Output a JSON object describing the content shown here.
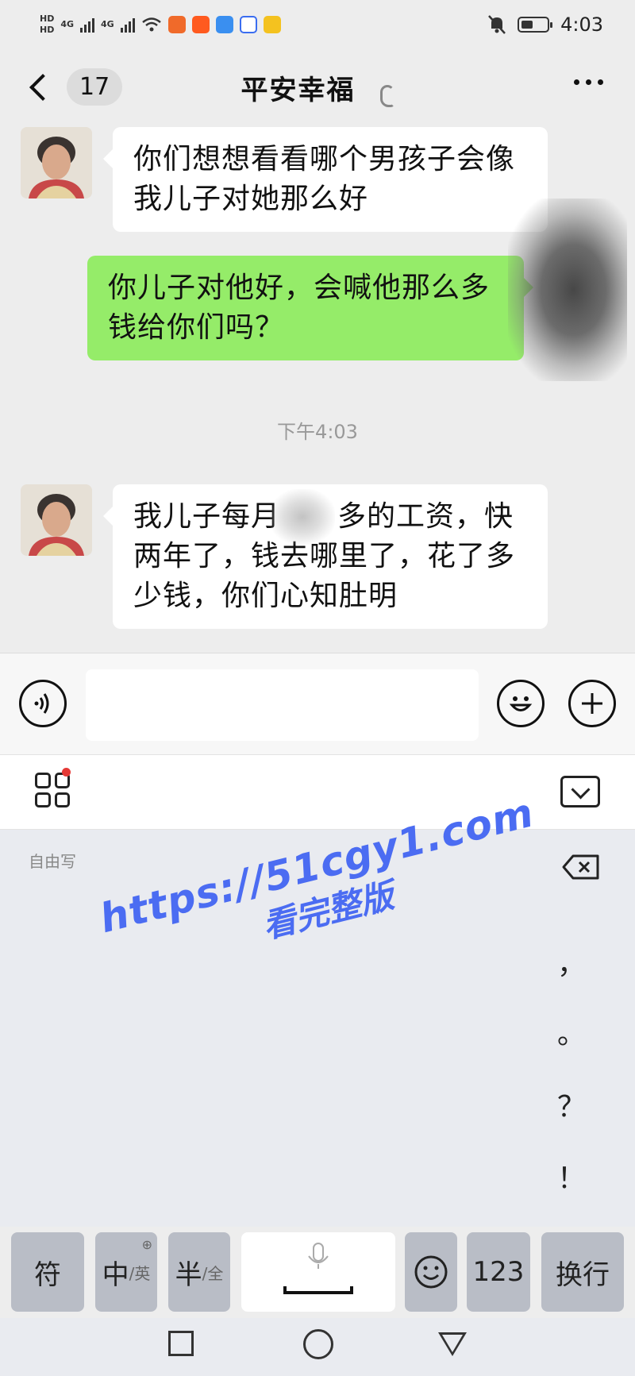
{
  "status_bar": {
    "time": "4:03",
    "network_1": "4G",
    "network_2": "4G",
    "hd_1": "HD",
    "hd_2": "HD",
    "icons": [
      "signal-icon",
      "wifi-icon",
      "mute-bell-icon",
      "battery-icon"
    ]
  },
  "header": {
    "back_count": "17",
    "title": "平安幸福"
  },
  "messages": [
    {
      "side": "in",
      "text_line1": "你们想想看看哪个男孩子会像",
      "text_line2": "我儿子对她那么好"
    },
    {
      "side": "out",
      "text_line1": "你儿子对他好，会喊他那么多",
      "text_line2": "钱给你们吗？"
    },
    {
      "side": "in",
      "text_line1": "我儿子每月",
      "text_line1b": "多的工资，快",
      "text_line2": "两年了，钱去哪里了，花了多",
      "text_line3": "少钱，你们心知肚明"
    }
  ],
  "timestamp": "下午4:03",
  "input": {
    "value": "",
    "placeholder": ""
  },
  "ime": {
    "mode_label": "自由写",
    "punctuation": [
      "，",
      "。",
      "？",
      "！"
    ],
    "keys": {
      "symbols": "符",
      "zh": "中",
      "zh_sub": "/英",
      "half": "半",
      "half_sub": "/全",
      "num": "123",
      "enter": "换行"
    }
  },
  "watermark": {
    "line1": "https://51cgy1.com",
    "line2": "看完整版"
  },
  "colors": {
    "outgoing_bubble": "#95ec69",
    "incoming_bubble": "#ffffff",
    "chat_bg": "#ededed",
    "watermark": "#4b6cf2"
  }
}
